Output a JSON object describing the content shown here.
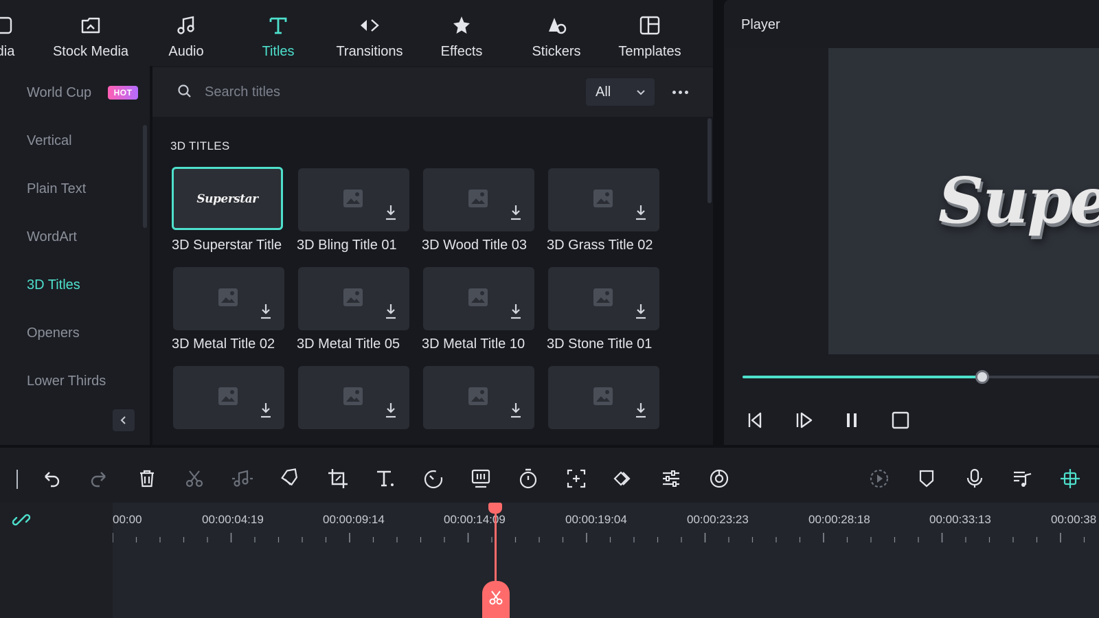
{
  "top_tabs": {
    "media_label": "dia",
    "stock_media": "Stock Media",
    "audio": "Audio",
    "titles": "Titles",
    "transitions": "Transitions",
    "effects": "Effects",
    "stickers": "Stickers",
    "templates": "Templates"
  },
  "sidebar": {
    "items": [
      {
        "label": "World Cup",
        "badge": "HOT"
      },
      {
        "label": "Vertical"
      },
      {
        "label": "Plain Text"
      },
      {
        "label": "WordArt"
      },
      {
        "label": "3D Titles",
        "active": true
      },
      {
        "label": "Openers"
      },
      {
        "label": "Lower Thirds"
      }
    ]
  },
  "search": {
    "placeholder": "Search titles",
    "filter_value": "All"
  },
  "section": {
    "title": "3D TITLES",
    "thumb_text": "Superstar",
    "items": [
      "3D Superstar Title",
      "3D Bling Title 01",
      "3D Wood Title 03",
      "3D Grass Title 02",
      "3D Metal Title 02",
      "3D Metal Title 05",
      "3D Metal Title 10",
      "3D Stone Title 01"
    ]
  },
  "player": {
    "title": "Player",
    "preview_text": "Super",
    "progress": 0.672
  },
  "timeline": {
    "timestamps": [
      "00:00",
      "00:00:04:19",
      "00:00:09:14",
      "00:00:14:09",
      "00:00:19:04",
      "00:00:23:23",
      "00:00:28:18",
      "00:00:33:13",
      "00:00:38"
    ]
  },
  "colors": {
    "accent": "#4ee0cc",
    "playhead": "#ff6b6b",
    "panel": "#1b1d23"
  }
}
